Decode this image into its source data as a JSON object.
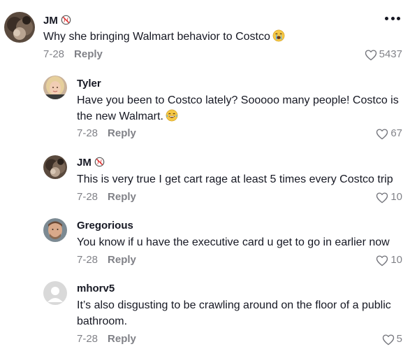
{
  "comments": [
    {
      "username": "JM",
      "verified_badge_icon": "no-baseball-icon",
      "text": "Why she bringing Walmart behavior to Costco",
      "emoji_icon": "crying-face-emoji",
      "date": "7-28",
      "reply_label": "Reply",
      "likes": "5437",
      "has_more_menu": true
    },
    {
      "username": "Tyler",
      "text_line1": "Have you been to Costco lately? Sooooo many people! Costco is",
      "text_line2": "the new Walmart.",
      "emoji_icon": "laughing-tears-emoji",
      "date": "7-28",
      "reply_label": "Reply",
      "likes": "67"
    },
    {
      "username": "JM",
      "verified_badge_icon": "no-baseball-icon",
      "text": "This is very true I get cart rage at least 5 times every Costco trip",
      "date": "7-28",
      "reply_label": "Reply",
      "likes": "10"
    },
    {
      "username": "Gregorious",
      "text": "You know if u have the executive card u get to go in earlier now",
      "date": "7-28",
      "reply_label": "Reply",
      "likes": "10"
    },
    {
      "username": "mhorv5",
      "text_line1": "It’s also disgusting to be crawling around on the floor of a public",
      "text_line2": "bathroom.",
      "date": "7-28",
      "reply_label": "Reply",
      "likes": "5"
    }
  ],
  "colors": {
    "text": "#161823",
    "muted": "rgba(22,24,35,0.55)",
    "default_avatar": "#d9d9d9"
  }
}
